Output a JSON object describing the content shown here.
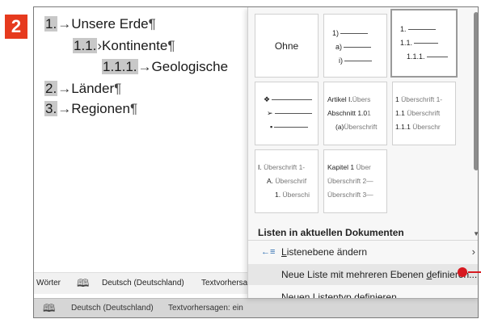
{
  "step_number": "2",
  "document": {
    "lines": [
      {
        "num": "1.",
        "arrow": "→",
        "text": "Unsere Erde",
        "mark": "¶"
      },
      {
        "num": "1.1.",
        "arrow": "›",
        "text": "Kontinente",
        "mark": "¶"
      },
      {
        "num": "1.1.1.",
        "arrow": "→",
        "text": "Geologische",
        "mark": ""
      },
      {
        "num": "2.",
        "arrow": "→",
        "text": "Länder",
        "mark": "¶"
      },
      {
        "num": "3.",
        "arrow": "→",
        "text": "Regionen",
        "mark": "¶"
      }
    ]
  },
  "statusbar": {
    "words": "Wörter",
    "language": "Deutsch (Deutschland)",
    "predictions": "Textvorhersa",
    "language2": "Deutsch (Deutschland)",
    "predictions2": "Textvorhersagen: ein"
  },
  "panel": {
    "tiles": {
      "none": "Ohne",
      "numbered": [
        {
          "label": "1)"
        },
        {
          "label": "a)"
        },
        {
          "label": "i)"
        }
      ],
      "decimal": [
        {
          "label": "1."
        },
        {
          "label": "1.1."
        },
        {
          "label": "1.1.1."
        }
      ],
      "bullets": [
        {
          "label": "❖"
        },
        {
          "label": "➢"
        },
        {
          "label": "▪"
        }
      ],
      "article": [
        {
          "label": "Artikel I.",
          "rest": "Übers"
        },
        {
          "label": "Abschnitt 1.0",
          "rest": "1"
        },
        {
          "label": "(a)",
          "rest": "Überschrift"
        }
      ],
      "heading_numbers": [
        {
          "label": "1",
          "rest": "Überschrift 1-"
        },
        {
          "label": "1.1",
          "rest": "Überschrift"
        },
        {
          "label": "1.1.1",
          "rest": "Überschr"
        }
      ],
      "roman": [
        {
          "label": "I.",
          "rest": "Überschrift 1-"
        },
        {
          "label": "A.",
          "rest": "Überschrif"
        },
        {
          "label": "1.",
          "rest": "Überschi"
        }
      ],
      "chapter": [
        {
          "label": "Kapitel 1",
          "rest": "Über"
        },
        {
          "label": "",
          "rest": "Überschrift 2—"
        },
        {
          "label": "",
          "rest": "Überschrift 3—"
        }
      ]
    },
    "section_heading": "Listen in aktuellen Dokumenten",
    "menu": [
      {
        "prefix": "L",
        "label_rest": "istenebene ändern"
      },
      {
        "before": "Neue Liste mit mehreren Ebenen ",
        "ul": "d",
        "after": "efinieren..."
      },
      {
        "prefix": "N",
        "label_rest": "euen Listentyp definieren..."
      }
    ]
  },
  "colors": {
    "badge": "#e63a1e",
    "pointer": "#d71920",
    "icon_blue": "#2b6cb0"
  },
  "icons": {
    "level": "list-level-icon",
    "submenu": "chevron-right-icon",
    "book": "book-icon"
  }
}
